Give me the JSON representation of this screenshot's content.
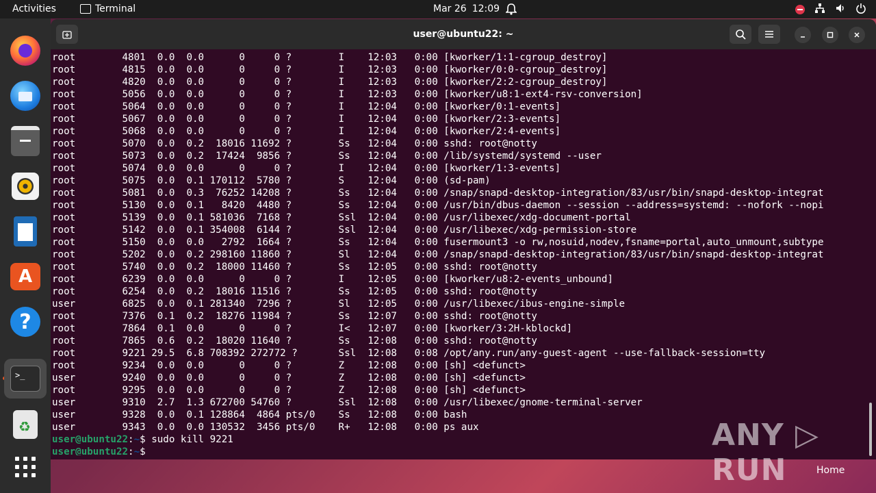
{
  "topbar": {
    "activities": "Activities",
    "app_name": "Terminal",
    "date": "Mar 26",
    "time": "12:09"
  },
  "window": {
    "title": "user@ubuntu22: ~"
  },
  "terminal": {
    "lines": [
      "root        4801  0.0  0.0      0     0 ?        I    12:03   0:00 [kworker/1:1-cgroup_destroy]",
      "root        4815  0.0  0.0      0     0 ?        I    12:03   0:00 [kworker/0:0-cgroup_destroy]",
      "root        4820  0.0  0.0      0     0 ?        I    12:03   0:00 [kworker/2:2-cgroup_destroy]",
      "root        5056  0.0  0.0      0     0 ?        I    12:03   0:00 [kworker/u8:1-ext4-rsv-conversion]",
      "root        5064  0.0  0.0      0     0 ?        I    12:04   0:00 [kworker/0:1-events]",
      "root        5067  0.0  0.0      0     0 ?        I    12:04   0:00 [kworker/2:3-events]",
      "root        5068  0.0  0.0      0     0 ?        I    12:04   0:00 [kworker/2:4-events]",
      "root        5070  0.0  0.2  18016 11692 ?        Ss   12:04   0:00 sshd: root@notty",
      "root        5073  0.0  0.2  17424  9856 ?        Ss   12:04   0:00 /lib/systemd/systemd --user",
      "root        5074  0.0  0.0      0     0 ?        I    12:04   0:00 [kworker/1:3-events]",
      "root        5075  0.0  0.1 170112  5780 ?        S    12:04   0:00 (sd-pam)",
      "root        5081  0.0  0.3  76252 14208 ?        Ss   12:04   0:00 /snap/snapd-desktop-integration/83/usr/bin/snapd-desktop-integrat",
      "root        5130  0.0  0.1   8420  4480 ?        Ss   12:04   0:00 /usr/bin/dbus-daemon --session --address=systemd: --nofork --nopi",
      "root        5139  0.0  0.1 581036  7168 ?        Ssl  12:04   0:00 /usr/libexec/xdg-document-portal",
      "root        5142  0.0  0.1 354008  6144 ?        Ssl  12:04   0:00 /usr/libexec/xdg-permission-store",
      "root        5150  0.0  0.0   2792  1664 ?        Ss   12:04   0:00 fusermount3 -o rw,nosuid,nodev,fsname=portal,auto_unmount,subtype",
      "root        5202  0.0  0.2 298160 11860 ?        Sl   12:04   0:00 /snap/snapd-desktop-integration/83/usr/bin/snapd-desktop-integrat",
      "root        5740  0.0  0.2  18000 11460 ?        Ss   12:05   0:00 sshd: root@notty",
      "root        6239  0.0  0.0      0     0 ?        I    12:05   0:00 [kworker/u8:2-events_unbound]",
      "root        6254  0.0  0.2  18016 11516 ?        Ss   12:05   0:00 sshd: root@notty",
      "user        6825  0.0  0.1 281340  7296 ?        Sl   12:05   0:00 /usr/libexec/ibus-engine-simple",
      "root        7376  0.1  0.2  18276 11984 ?        Ss   12:07   0:00 sshd: root@notty",
      "root        7864  0.1  0.0      0     0 ?        I<   12:07   0:00 [kworker/3:2H-kblockd]",
      "root        7865  0.6  0.2  18020 11640 ?        Ss   12:08   0:00 sshd: root@notty",
      "root        9221 29.5  6.8 708392 272772 ?       Ssl  12:08   0:08 /opt/any.run/any-guest-agent --use-fallback-session=tty",
      "root        9234  0.0  0.0      0     0 ?        Z    12:08   0:00 [sh] <defunct>",
      "user        9240  0.0  0.0      0     0 ?        Z    12:08   0:00 [sh] <defunct>",
      "root        9295  0.0  0.0      0     0 ?        Z    12:08   0:00 [sh] <defunct>",
      "user        9310  2.7  1.3 672700 54760 ?        Ssl  12:08   0:00 /usr/libexec/gnome-terminal-server",
      "user        9328  0.0  0.1 128864  4864 pts/0    Ss   12:08   0:00 bash",
      "user        9343  0.0  0.0 130532  3456 pts/0    R+   12:08   0:00 ps aux"
    ],
    "prompt_user": "user@ubuntu22",
    "prompt_sep": ":",
    "prompt_path": "~",
    "prompt_symbol": "$",
    "command1": " sudo kill 9221",
    "command2": " "
  },
  "watermark": "ANY ▷ RUN",
  "desktop": {
    "home_label": "Home"
  }
}
